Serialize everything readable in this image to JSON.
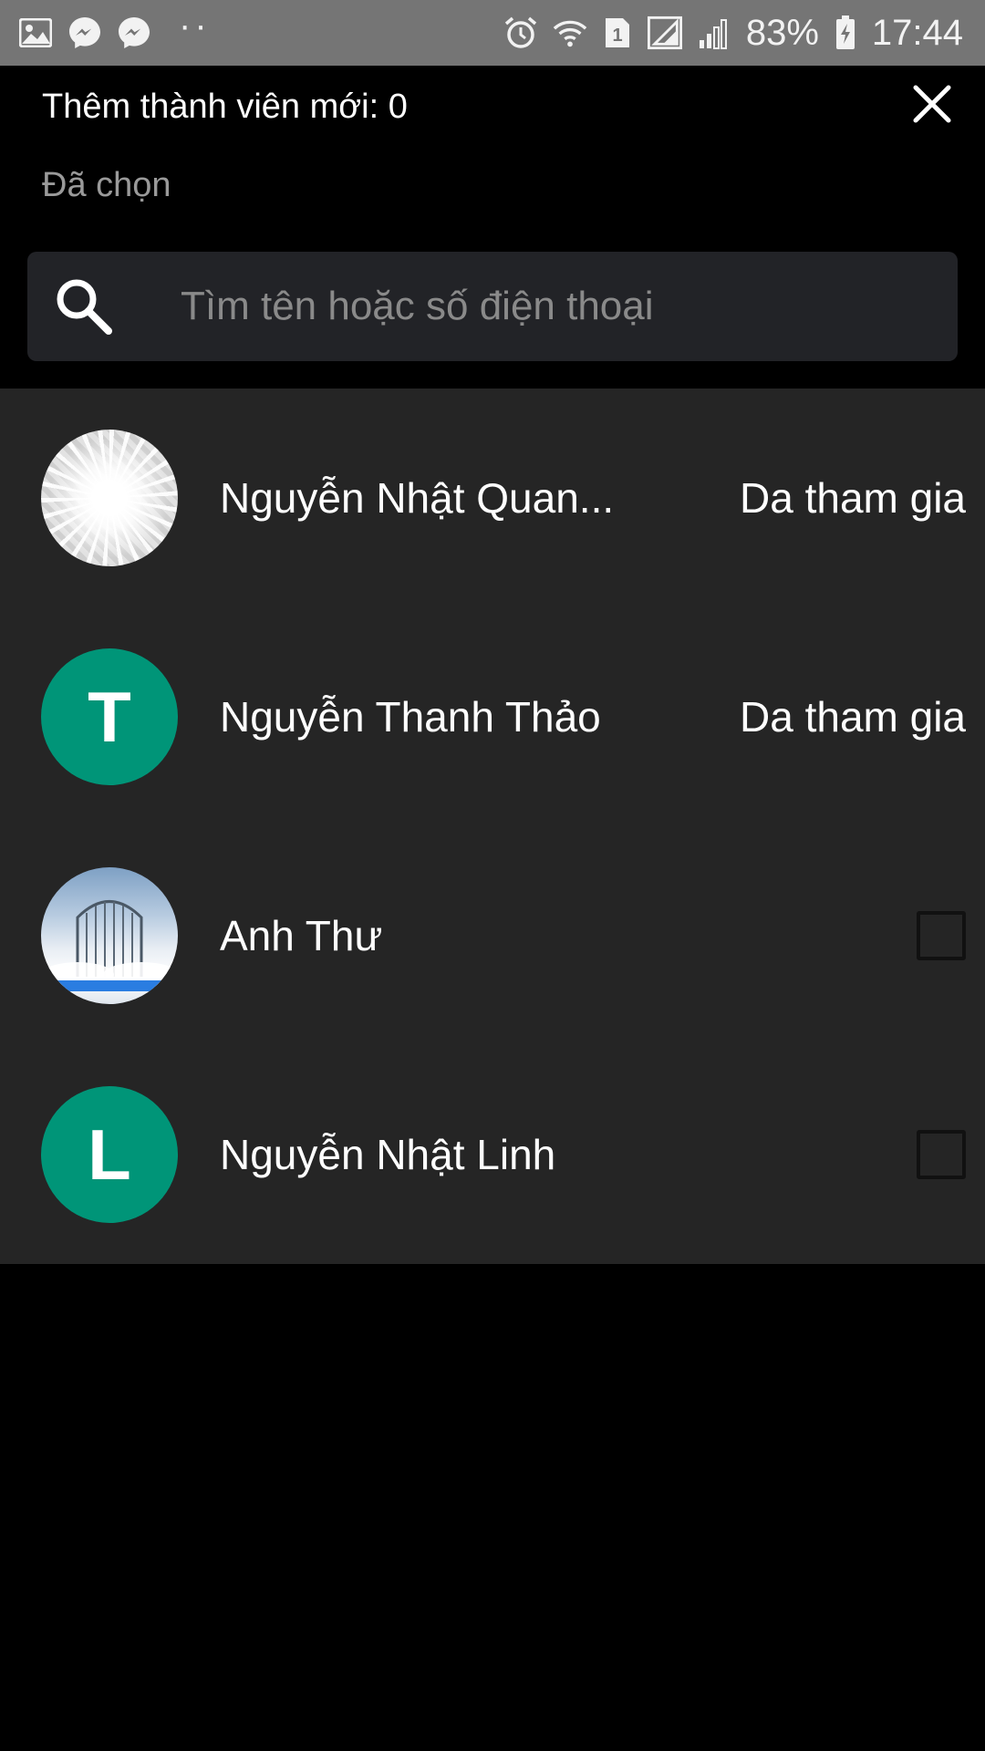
{
  "status_bar": {
    "battery": "83%",
    "time": "17:44",
    "sim_slot": "1",
    "notification_icons": [
      "gallery-icon",
      "messenger-icon",
      "messenger-icon"
    ],
    "system_icons": [
      "alarm-icon",
      "wifi-icon",
      "sim-icon",
      "signal-icon",
      "signal-icon",
      "battery-charging-icon"
    ]
  },
  "header": {
    "title": "Thêm thành viên mới: 0",
    "selected_label": "Đã chọn",
    "close_icon": "close-icon"
  },
  "search": {
    "placeholder": "Tìm tên hoặc số điện thoại",
    "value": "",
    "icon": "search-icon"
  },
  "members": [
    {
      "name": "Nguyễn Nhật Quan...",
      "avatar": "image",
      "status": "Da tham gia",
      "checked": null
    },
    {
      "name": "Nguyễn Thanh Thảo",
      "avatar_letter": "T",
      "status": "Da tham gia",
      "checked": null
    },
    {
      "name": "Anh Thư",
      "avatar": "image",
      "status": "",
      "checked": false
    },
    {
      "name": "Nguyễn Nhật Linh",
      "avatar_letter": "L",
      "status": "",
      "checked": false
    }
  ],
  "colors": {
    "status_bar_bg": "#757575",
    "header_bg": "#000000",
    "search_bg": "#222327",
    "list_bg": "#252525",
    "avatar_accent": "#009578"
  }
}
